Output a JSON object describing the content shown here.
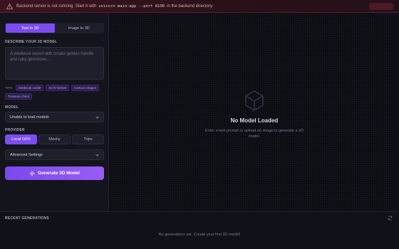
{
  "banner": {
    "text_before": "Backend server is not running. Start it with",
    "command": "uvicorn main:app --port 8100",
    "text_after": "in the backend directory.",
    "icon": "warning-triangle-icon"
  },
  "mode_tabs": [
    "Text to 3D",
    "Image to 3D"
  ],
  "describe": {
    "label": "DESCRIBE YOUR 3D MODEL",
    "placeholder": "A medieval sword with ornate golden handle and ruby gemstone..."
  },
  "tips": {
    "label": "TIPS:",
    "chips": [
      "Medieval castle",
      "Sci-fi helmet",
      "Cartoon dragon",
      "Treasure chest"
    ]
  },
  "model": {
    "label": "MODEL",
    "value": "Unable to load models"
  },
  "provider": {
    "label": "PROVIDER",
    "options": [
      "Local GPU",
      "Meshy",
      "Tripo"
    ]
  },
  "advanced_label": "Advanced Settings",
  "generate_label": "Generate 3D Model",
  "viewer": {
    "title": "No Model Loaded",
    "subtitle": "Enter a text prompt or upload an image to generate a 3D model."
  },
  "recent": {
    "label": "RECENT GENERATIONS",
    "empty": "No generations yet. Create your first 3D model!"
  },
  "colors": {
    "accent": "#7c4cf0",
    "error_banner": "#3a1420",
    "background": "#0d0d14"
  }
}
